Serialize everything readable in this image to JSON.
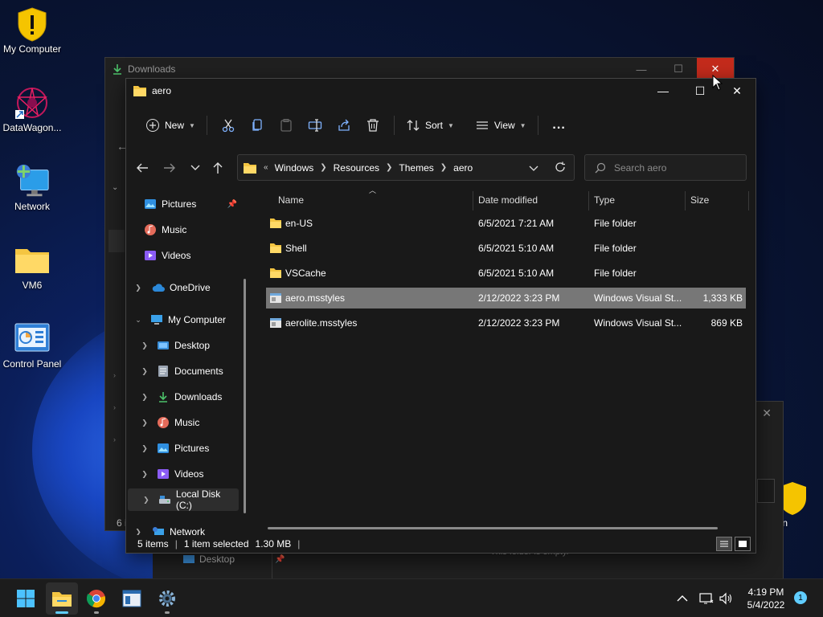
{
  "desktop": {
    "icons": [
      {
        "label": "My Computer"
      },
      {
        "label": "DataWagon..."
      },
      {
        "label": "Network"
      },
      {
        "label": "VM6"
      },
      {
        "label": "Control Panel"
      },
      {
        "label": "le Bin"
      }
    ]
  },
  "back_window": {
    "title": "Downloads",
    "status_fragment": "6 i",
    "nav_desktop": "Desktop",
    "empty_text": "This folder is empty."
  },
  "window": {
    "title": "aero",
    "toolbar": {
      "new_label": "New",
      "sort_label": "Sort",
      "view_label": "View",
      "more_label": "..."
    },
    "address": {
      "overflow": "«",
      "crumbs": [
        "Windows",
        "Resources",
        "Themes",
        "aero"
      ]
    },
    "search": {
      "placeholder": "Search aero"
    },
    "nav": {
      "pictures": "Pictures",
      "music": "Music",
      "videos": "Videos",
      "onedrive": "OneDrive",
      "my_computer": "My Computer",
      "desktop": "Desktop",
      "documents": "Documents",
      "downloads": "Downloads",
      "music2": "Music",
      "pictures2": "Pictures",
      "videos2": "Videos",
      "local_disk": "Local Disk (C:)",
      "network": "Network"
    },
    "columns": {
      "name": "Name",
      "date": "Date modified",
      "type": "Type",
      "size": "Size"
    },
    "files": [
      {
        "name": "en-US",
        "date": "6/5/2021 7:21 AM",
        "type": "File folder",
        "size": ""
      },
      {
        "name": "Shell",
        "date": "6/5/2021 5:10 AM",
        "type": "File folder",
        "size": ""
      },
      {
        "name": "VSCache",
        "date": "6/5/2021 5:10 AM",
        "type": "File folder",
        "size": ""
      },
      {
        "name": "aero.msstyles",
        "date": "2/12/2022 3:23 PM",
        "type": "Windows Visual St...",
        "size": "1,333 KB"
      },
      {
        "name": "aerolite.msstyles",
        "date": "2/12/2022 3:23 PM",
        "type": "Windows Visual St...",
        "size": "869 KB"
      }
    ],
    "status": {
      "items": "5 items",
      "selected": "1 item selected",
      "size": "1.30 MB"
    }
  },
  "taskbar": {
    "time": "4:19 PM",
    "date": "5/4/2022",
    "notifications": "1"
  },
  "colors": {
    "accent": "#60cdff",
    "folder": "#f4c542",
    "close_red": "#c42b1c"
  }
}
